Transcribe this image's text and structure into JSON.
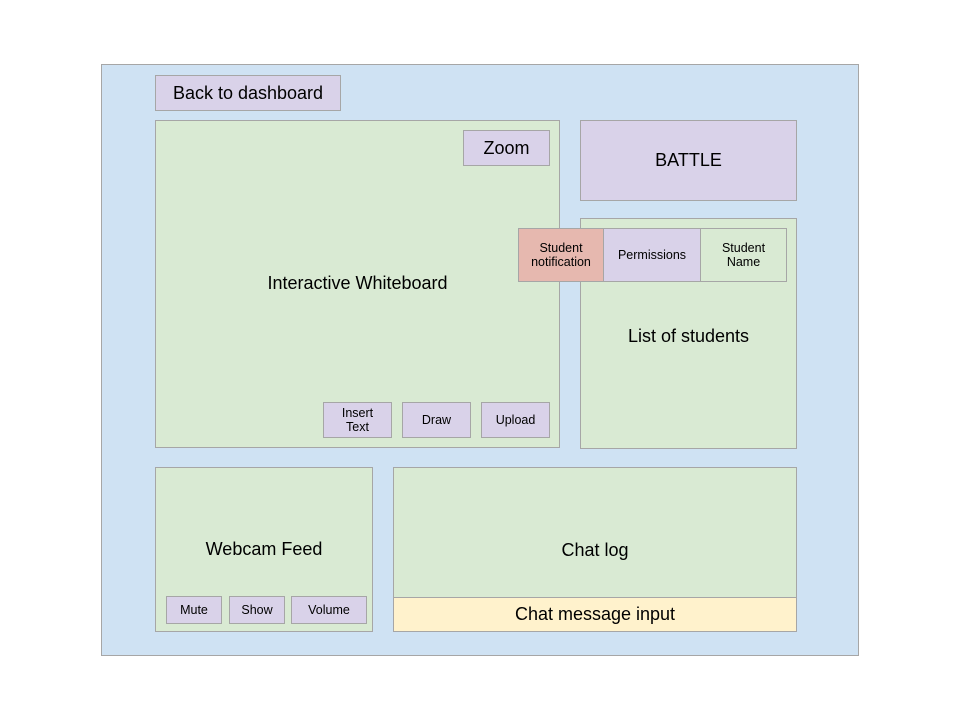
{
  "header": {
    "back_label": "Back to dashboard"
  },
  "whiteboard": {
    "label": "Interactive Whiteboard",
    "zoom_label": "Zoom",
    "insert_text_label": "Insert Text",
    "draw_label": "Draw",
    "upload_label": "Upload"
  },
  "battle": {
    "label": "BATTLE"
  },
  "students": {
    "label": "List of students",
    "row": {
      "notification": "Student notification",
      "permissions": "Permissions",
      "name": "Student Name"
    }
  },
  "webcam": {
    "label": "Webcam Feed",
    "mute_label": "Mute",
    "show_label": "Show",
    "volume_label": "Volume"
  },
  "chat": {
    "log_label": "Chat log",
    "input_placeholder": "Chat message input"
  },
  "colors": {
    "background": "#cfe2f3",
    "panel": "#d9ead3",
    "button": "#d9d2e9",
    "notification": "#e6b8af",
    "input": "#fff2cc"
  }
}
